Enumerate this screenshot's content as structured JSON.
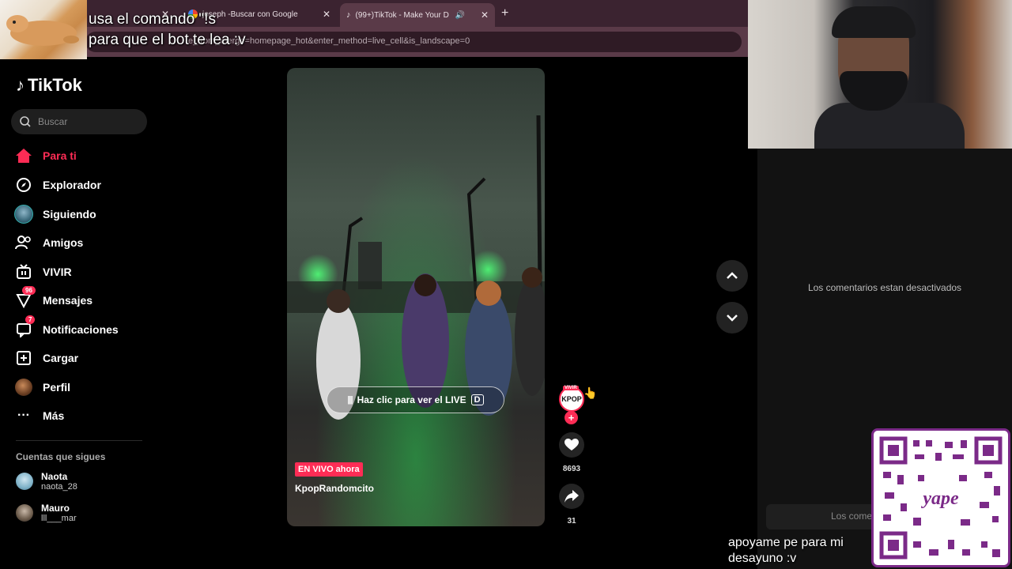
{
  "browser": {
    "tabs": [
      {
        "label": "",
        "close": "✕"
      },
      {
        "label": "joseph -Buscar con Google",
        "close": "✕"
      },
      {
        "label": "(99+)TikTok - Make Your D",
        "close": "✕"
      }
    ],
    "new_tab": "+",
    "url": "e_from_merge=homepage_hot&enter_method=live_cell&is_landscape=0"
  },
  "overlay": {
    "line1": "usa el comando \"!s",
    "line2": "para que el bot te lea :v"
  },
  "sidebar": {
    "logo": "TikTok",
    "search_placeholder": "Buscar",
    "nav": [
      {
        "label": "Para ti",
        "icon": "home-icon"
      },
      {
        "label": "Explorador",
        "icon": "compass-icon"
      },
      {
        "label": "Siguiendo",
        "icon": "avatar-icon"
      },
      {
        "label": "Amigos",
        "icon": "friends-icon"
      },
      {
        "label": "VIVIR",
        "icon": "live-tv-icon"
      },
      {
        "label": "Mensajes",
        "icon": "messages-icon",
        "badge": "96"
      },
      {
        "label": "Notificaciones",
        "icon": "notifications-icon",
        "badge": "7"
      },
      {
        "label": "Cargar",
        "icon": "upload-icon"
      },
      {
        "label": "Perfil",
        "icon": "profile-icon"
      },
      {
        "label": "Más",
        "icon": "more-icon"
      }
    ],
    "following_title": "Cuentas que sigues",
    "accounts": [
      {
        "name": "Naota",
        "handle": "naota_28"
      },
      {
        "name": "Mauro",
        "handle": "lll___mar"
      }
    ]
  },
  "video": {
    "live_button": "Haz clic para ver el LIVE",
    "live_key": "D",
    "live_tag": "EN VIVO ahora",
    "username": "KpopRandomcito"
  },
  "actions": {
    "avatar_live_label": "VIVIR",
    "avatar_text": "KPOP",
    "likes": "8693",
    "shares": "31"
  },
  "comments": {
    "disabled_text": "Los comentarios estan desactivados",
    "input_placeholder": "Los comentarios"
  },
  "donate": {
    "line1": "apoyame pe para mi",
    "line2": "desayuno :v"
  },
  "colors": {
    "accent": "#fe2c55",
    "browser_bg": "#3b2330",
    "qr_border": "#7b2a88"
  }
}
